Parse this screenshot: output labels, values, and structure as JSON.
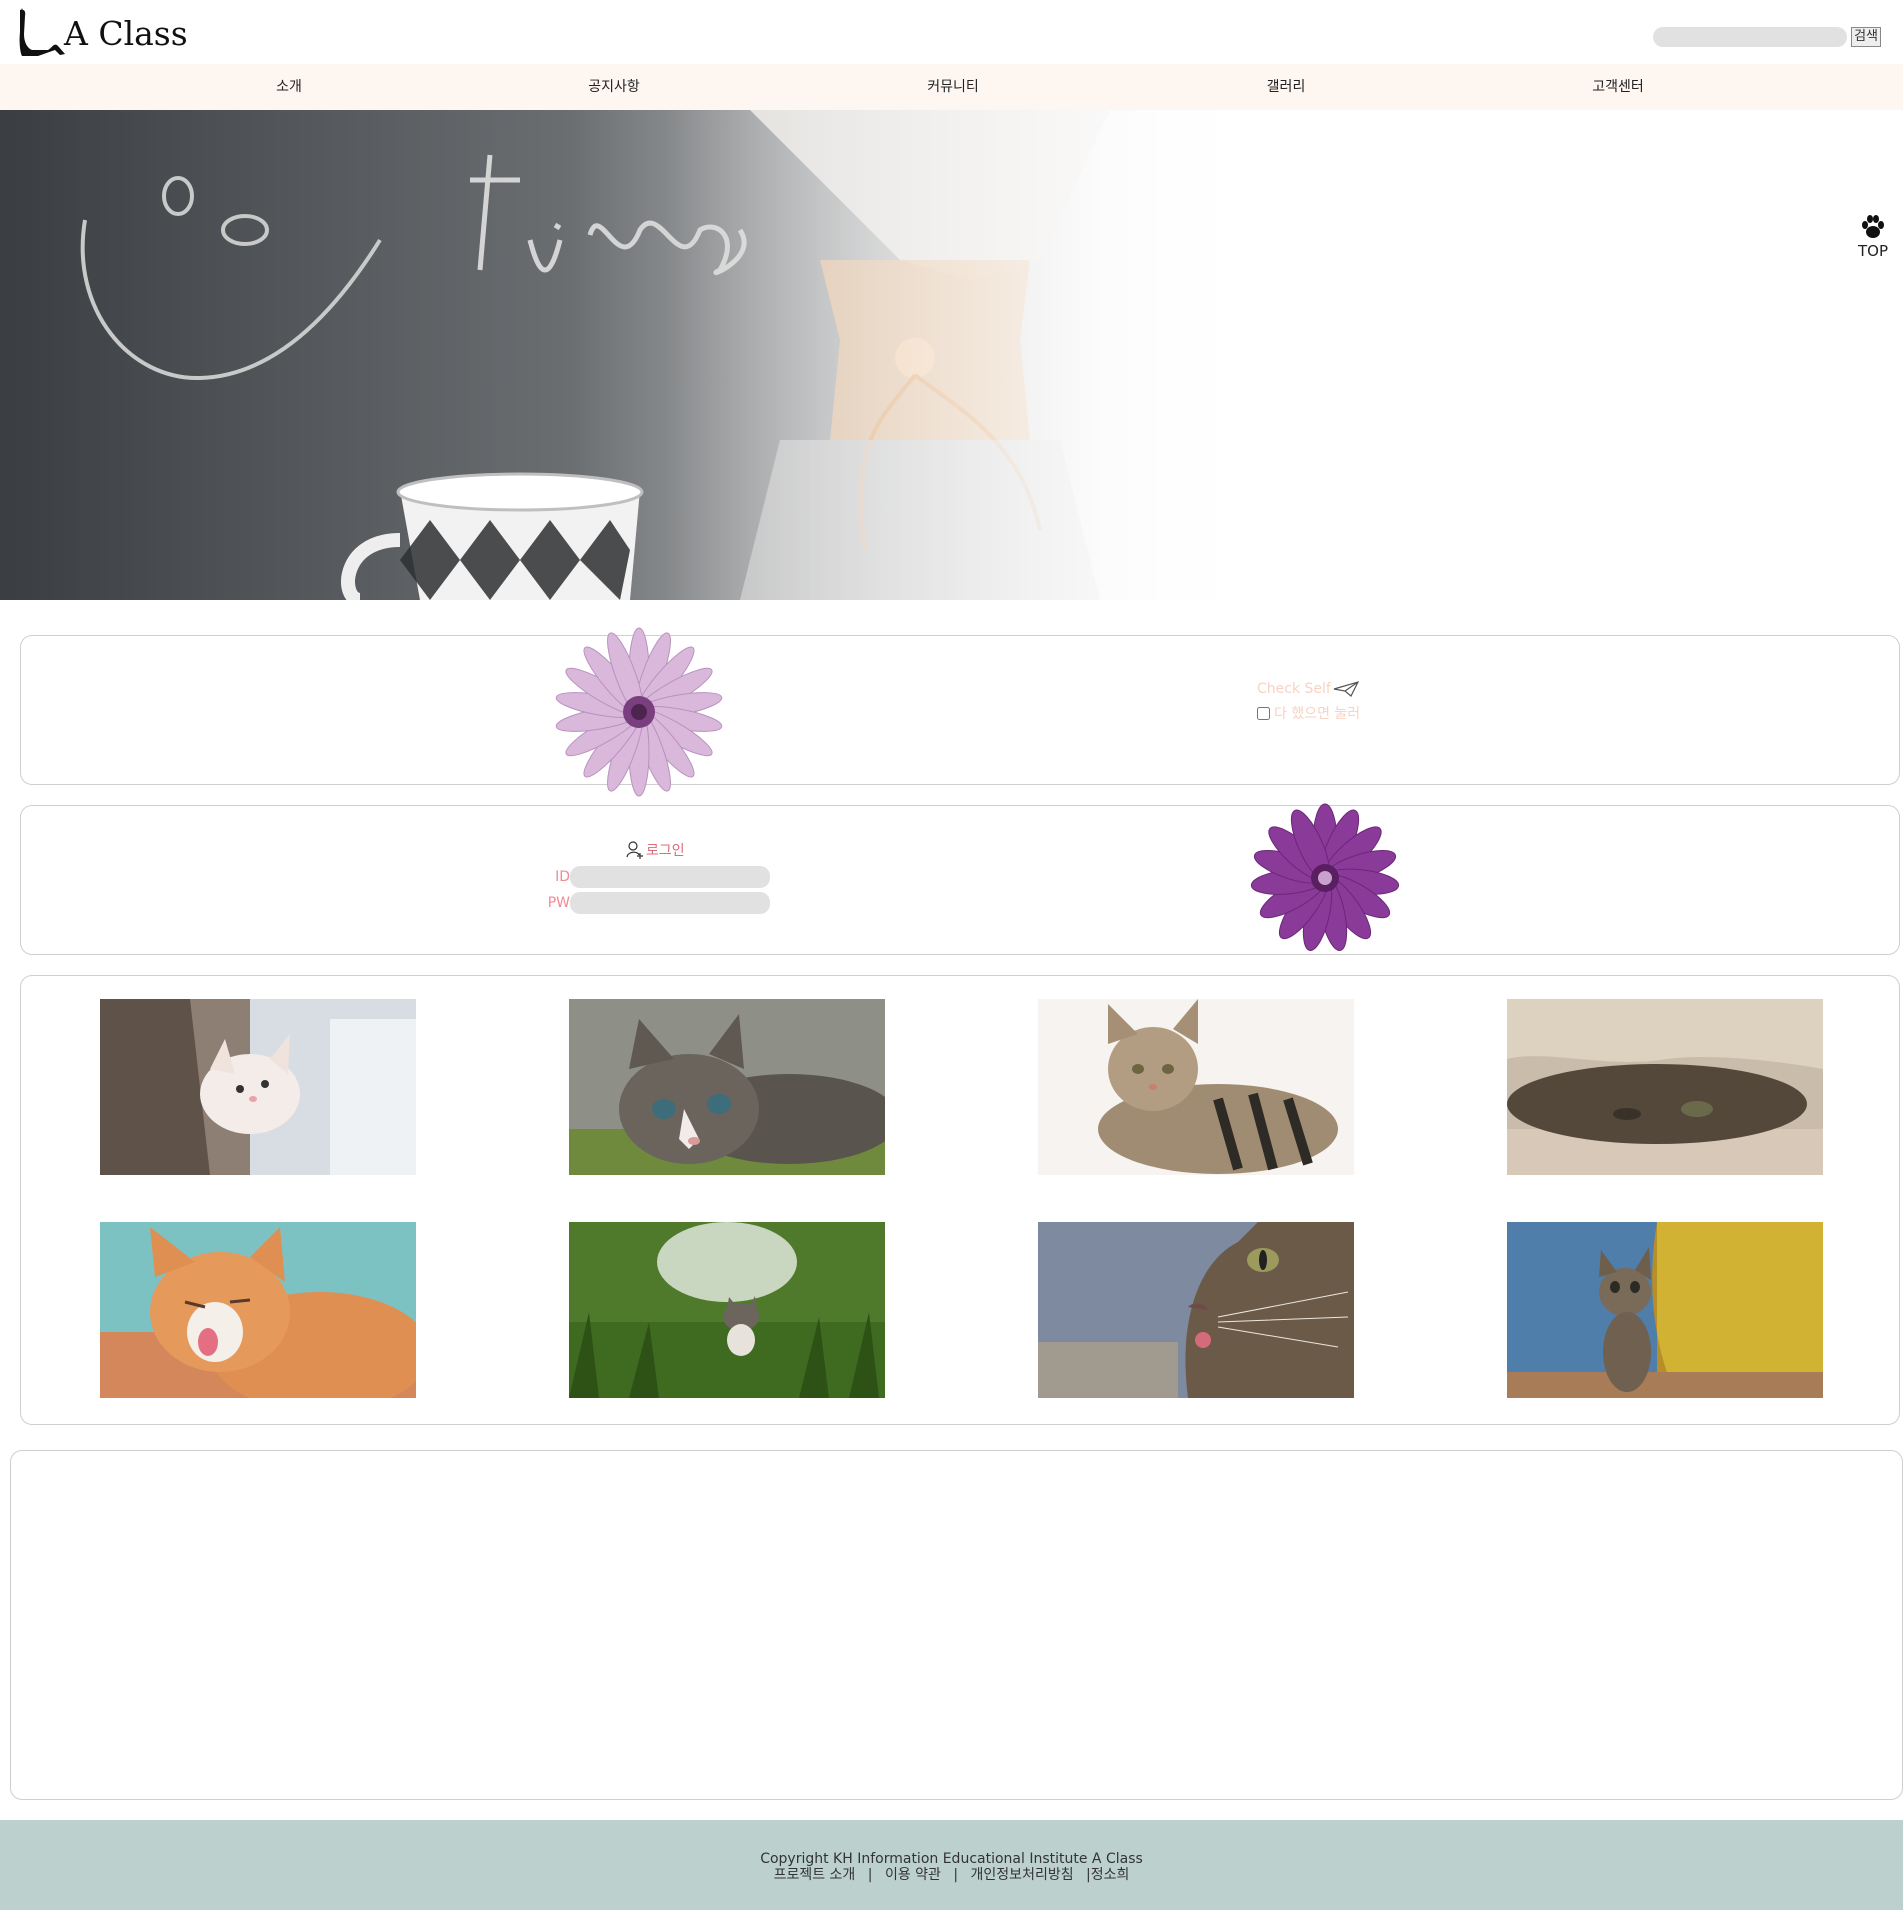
{
  "header": {
    "logo_text": "A Class",
    "search_button": "검색"
  },
  "nav": {
    "items": [
      "소개",
      "공지사항",
      "커뮤니티",
      "갤러리",
      "고객센터"
    ]
  },
  "top_button": {
    "label": "TOP",
    "icon": "paw-icon"
  },
  "check_self": {
    "title": "Check Self",
    "checkbox_label": "다 했으면 눌러",
    "checked": false,
    "icon": "paper-plane-icon"
  },
  "login": {
    "title": "로그인",
    "id_label": "ID",
    "pw_label": "PW",
    "icon": "user-add-icon"
  },
  "gallery": {
    "images": [
      "cat-photo-1",
      "cat-photo-2",
      "cat-photo-3",
      "cat-photo-4",
      "cat-photo-5",
      "cat-photo-6",
      "cat-photo-7",
      "cat-photo-8"
    ]
  },
  "footer": {
    "copyright": "Copyright KH Information Educational Institute A Class",
    "links": [
      "프로젝트 소개",
      "|",
      "이용 약관",
      "|",
      "개인정보처리방침",
      "|정소희"
    ]
  },
  "colors": {
    "nav_bg": "#fdf6f1",
    "footer_bg": "#bcd1ce",
    "login_accent": "#e16b7a",
    "check_accent": "#f9d2c2"
  }
}
